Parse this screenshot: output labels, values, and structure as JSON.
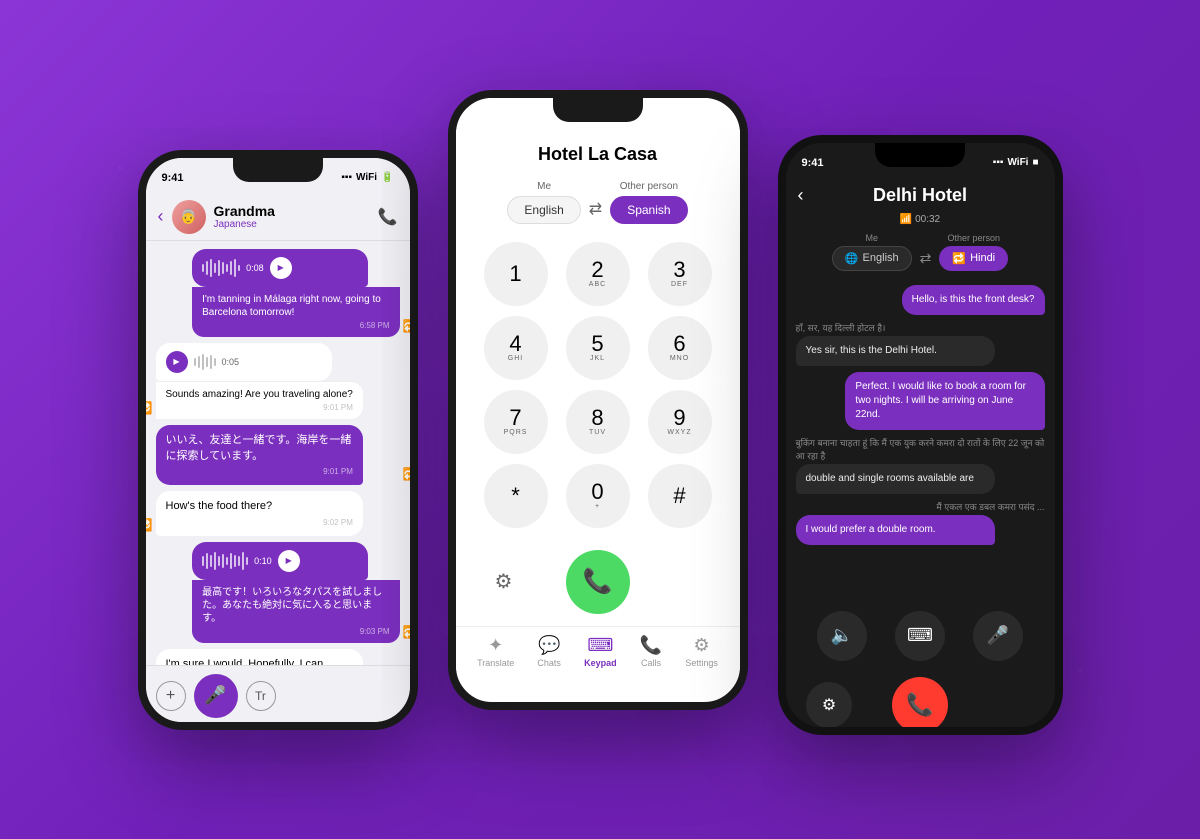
{
  "background": {
    "color": "#7B2FBE"
  },
  "phone_left": {
    "status_time": "9:41",
    "contact_name": "Grandma",
    "contact_language": "Japanese",
    "messages": [
      {
        "type": "voice_sent",
        "duration": "0:08",
        "translation": "I'm tanning in Málaga right now, going to Barcelona tomorrow!",
        "time": "6:58 PM"
      },
      {
        "type": "voice_received",
        "duration": "0:05",
        "translation": "Sounds amazing! Are you traveling alone?",
        "time": "9:01 PM"
      },
      {
        "type": "text_sent",
        "text": "いいえ、友達と一緒です。海岸を一緒に探索しています。",
        "time": "9:01 PM"
      },
      {
        "type": "text_received",
        "text": "How's the food there?",
        "time": "9:02 PM"
      },
      {
        "type": "voice_sent",
        "duration": "0:10",
        "translation": "最高です！いろいろなタパスを試しました。あなたも絶対に気に入ると思います。",
        "time": "9:03 PM"
      },
      {
        "type": "text_received",
        "text": "I'm sure I would. Hopefully, I can travel there soon and experience it myself.",
        "time": ""
      }
    ],
    "input_placeholder": "",
    "add_label": "+",
    "translate_label": "Tr"
  },
  "phone_center": {
    "title": "Hotel La Casa",
    "me_label": "Me",
    "other_label": "Other person",
    "me_lang": "English",
    "other_lang": "Spanish",
    "keys": [
      {
        "number": "1",
        "letters": ""
      },
      {
        "number": "2",
        "letters": "ABC"
      },
      {
        "number": "3",
        "letters": "DEF"
      },
      {
        "number": "4",
        "letters": "GHI"
      },
      {
        "number": "5",
        "letters": "JKL"
      },
      {
        "number": "6",
        "letters": "MNO"
      },
      {
        "number": "7",
        "letters": "PQRS"
      },
      {
        "number": "8",
        "letters": "TUV"
      },
      {
        "number": "9",
        "letters": "WXYZ"
      },
      {
        "number": "*",
        "letters": ""
      },
      {
        "number": "0",
        "letters": "+"
      },
      {
        "number": "#",
        "letters": ""
      }
    ],
    "nav": [
      {
        "label": "Translate",
        "icon": "✦",
        "active": false
      },
      {
        "label": "Chats",
        "icon": "💬",
        "active": false
      },
      {
        "label": "Keypad",
        "icon": "⌨",
        "active": true
      },
      {
        "label": "Calls",
        "icon": "📞",
        "active": false
      },
      {
        "label": "Settings",
        "icon": "⚙",
        "active": false
      }
    ]
  },
  "phone_right": {
    "status_time": "9:41",
    "title": "Delhi Hotel",
    "call_status": "📶 00:32",
    "me_label": "Me",
    "other_label": "Other person",
    "me_lang": "English",
    "other_lang": "Hindi",
    "messages": [
      {
        "type": "sent",
        "text": "Hello, is this the front desk?"
      },
      {
        "type": "received",
        "original": "हाँ, सर, यह दिल्ली होटल है।",
        "translated": "Yes sir, this is the Delhi Hotel."
      },
      {
        "type": "sent",
        "text": "Perfect. I would like to book a room for two nights. I will be arriving on June 22nd."
      },
      {
        "type": "received",
        "original": "बुकिंग बनाना चाहता हूं कि मैं एक युक करने कमरा दो रातों के लिए 22 जून को आ रहा है",
        "translated": "double and single rooms available are"
      },
      {
        "type": "sent",
        "text": "I would prefer a double room."
      }
    ]
  }
}
